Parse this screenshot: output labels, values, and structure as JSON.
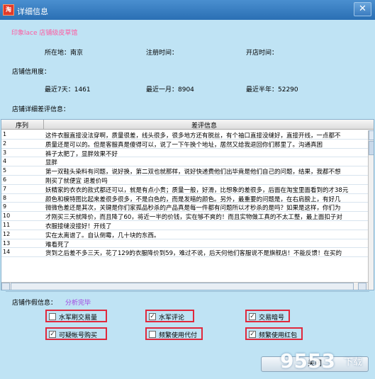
{
  "window": {
    "title": "详细信息",
    "app_icon_text": "淘",
    "close_glyph": "✕"
  },
  "shop": {
    "name": "印象lace 店铺级皮草馆"
  },
  "location": {
    "label": "所在地：南京",
    "register_label": "注册时间：",
    "open_label": "开店时间："
  },
  "credit": {
    "section_label": "店铺信用度：",
    "week": "最近7天：1461",
    "month": "最近一月：8904",
    "half_year": "最近半年：52290"
  },
  "reviews": {
    "section_label": "店铺详细差评信息：",
    "col_index": "序列",
    "col_review": "差评信息",
    "rows": [
      {
        "no": "1",
        "text": "这件衣服直接没法穿啊，质量很差，线头很多，很多地方还有脱丝，有个袖口直接没缝好，直接开线，一点都不"
      },
      {
        "no": "2",
        "text": "       质量还是可以的。但是客服真是傻得可以，说了一下午换个地址，居然又给我退回你们那里了。沟通真困"
      },
      {
        "no": "3",
        "text": "裤子太肥了，显胖效果不好"
      },
      {
        "no": "4",
        "text": "显胖"
      },
      {
        "no": "5",
        "text": "第一双鞋头染料有问题，说好换，第二双也就那样，说好快递费他们出毕竟是他们自己的问题，结果，我都不想"
      },
      {
        "no": "6",
        "text": "刚买了就便宜 退差价吗"
      },
      {
        "no": "7",
        "text": "妖精家的衣衣的款式都还可以，就是有点小贵；质量一般，好滑，比想象的差很多，后面在淘宝里面看到的才38元"
      },
      {
        "no": "8",
        "text": "颜色和模特图比起来差很多很多，不是白色的，而是发暗的颜色。另外，最重要的问题是，在右肩膀上，有好几"
      },
      {
        "no": "9",
        "text": "微微色差还是其次，关键是你们家孤品秒杀的产品真是每一件都有问题所以才秒杀的是吗？如果是这样，你们为"
      },
      {
        "no": "10",
        "text": "才刚买三天就降价，而且降了60，将近一半的价钱，实在够不爽的！而且实物做工真的不太工整，最上面扣子对"
      },
      {
        "no": "11",
        "text": "衣服接缝没接好！开线了"
      },
      {
        "no": "12",
        "text": "实在太离谱了。自认倒霉，几十块的东西。"
      },
      {
        "no": "13",
        "text": "难看死了"
      },
      {
        "no": "14",
        "text": "货到之后差不多三天，花了129的衣服降价到59，难过不说，后天何他们客服说不是旗舰店！不能反馈！在买的"
      }
    ]
  },
  "fraud": {
    "section_label": "店铺作假信息：",
    "analysis_status": "分析完毕",
    "items": [
      {
        "label": "水军刷交易量",
        "checked": false
      },
      {
        "label": "水军评论",
        "checked": true
      },
      {
        "label": "交易暗号",
        "checked": true
      },
      {
        "label": "可疑帐号购买",
        "checked": true
      },
      {
        "label": "频繁使用代付",
        "checked": false
      },
      {
        "label": "频繁使用红包",
        "checked": true
      }
    ]
  },
  "buttons": {
    "close_label": "关闭"
  },
  "watermark": {
    "text": "9553",
    "sub": "下载"
  },
  "colors": {
    "titlebar": "#2a6fb4",
    "background": "#bfe3f4",
    "highlight_border": "#e0283c",
    "shop_name": "#ff5aa0",
    "analysis_status": "#a040e0"
  }
}
